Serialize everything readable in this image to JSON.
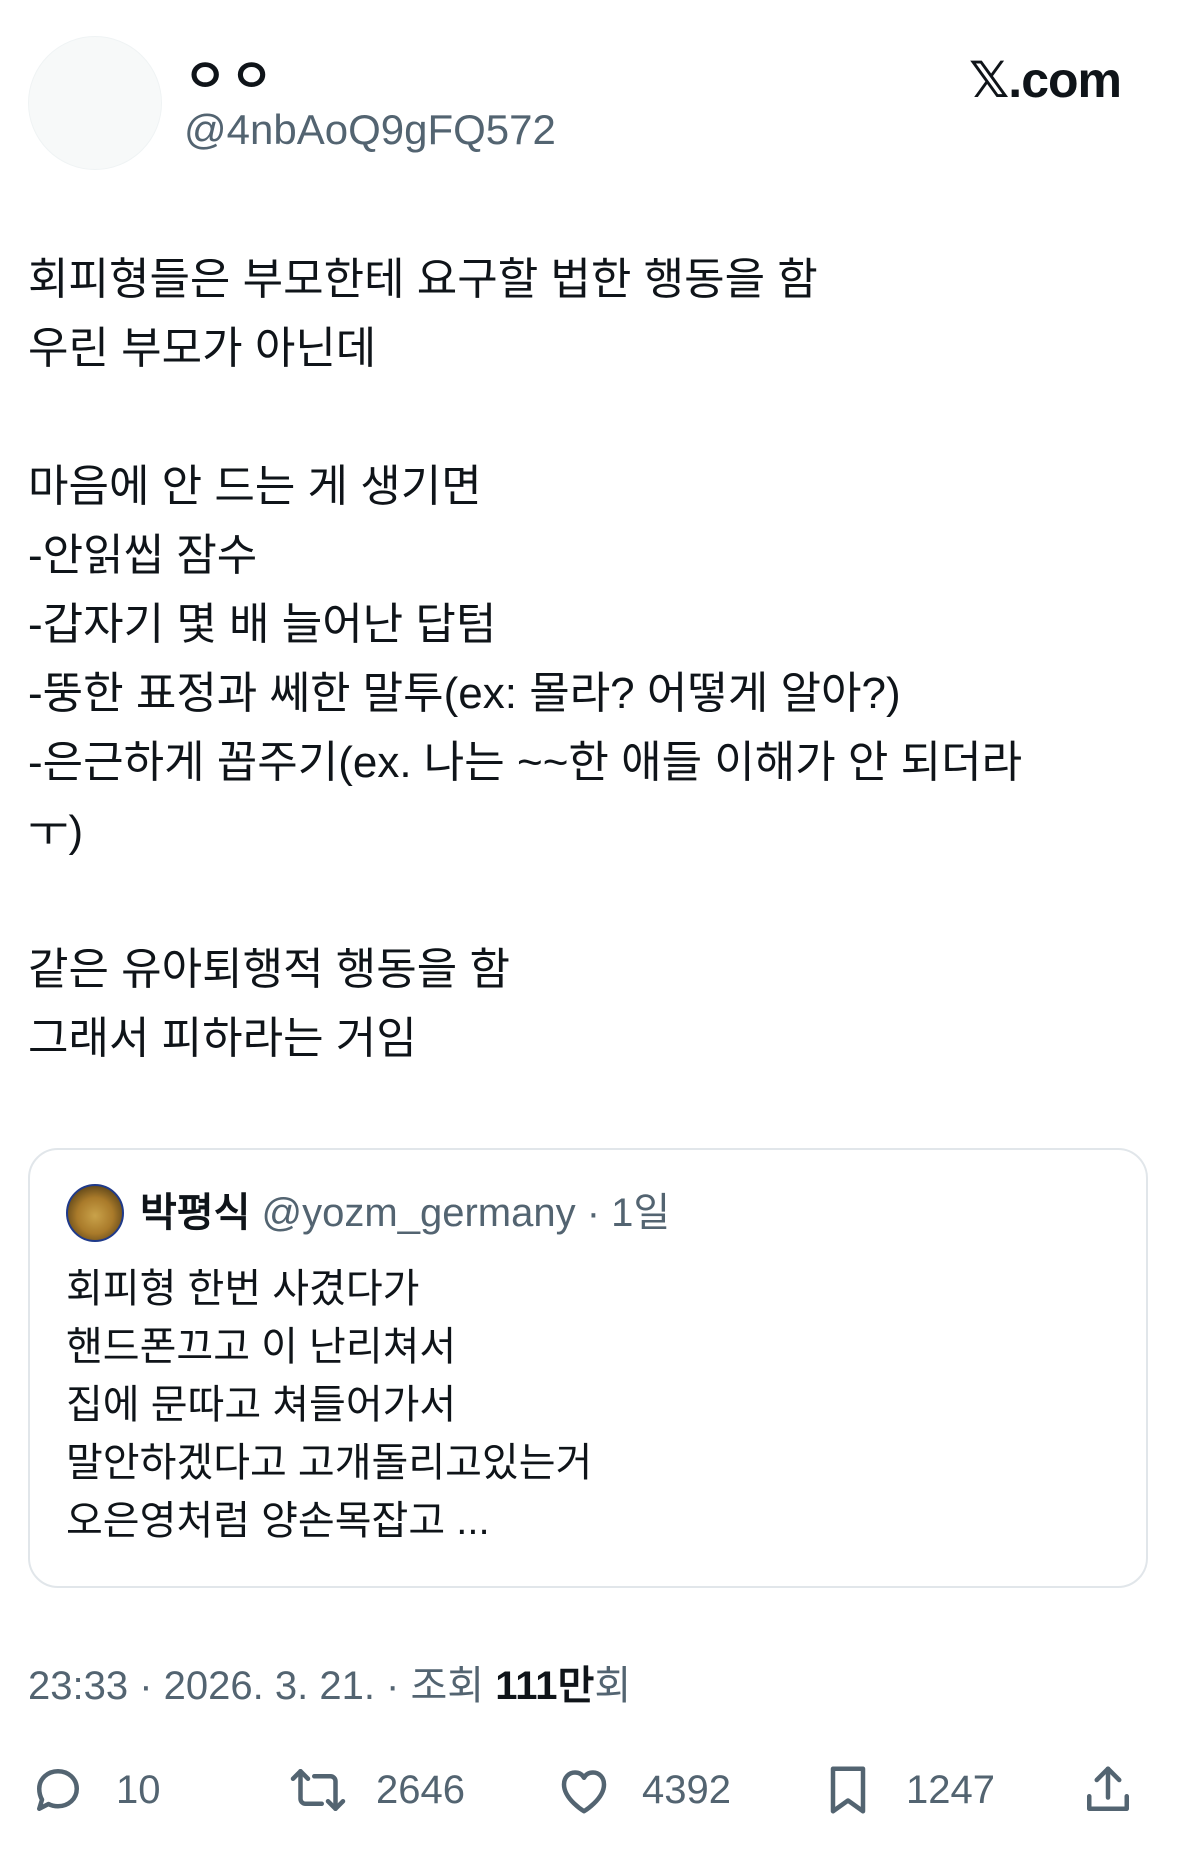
{
  "header": {
    "display_name": "ㅇㅇ",
    "handle": "@4nbAoQ9gFQ572",
    "brand": "𝕏.com"
  },
  "tweet": {
    "lines": [
      "회피형들은 부모한테 요구할 법한 행동을 함",
      "우린 부모가 아닌데",
      "",
      "마음에 안 드는 게 생기면",
      "-안읽씹 잠수",
      "-갑자기 몇 배 늘어난 답텀",
      "-뚱한 표정과 쎄한 말투(ex: 몰라? 어떻게 알아?)",
      "-은근하게 꼽주기(ex. 나는 ~~한 애들 이해가 안 되더라",
      "ㅜ)",
      "",
      "같은 유아퇴행적 행동을 함",
      "그래서 피하라는 거임"
    ]
  },
  "quote": {
    "name": "박평식",
    "meta": "@yozm_germany · 1일",
    "lines": [
      "회피형 한번 사겼다가",
      "핸드폰끄고 이 난리쳐서",
      "집에 문따고 쳐들어가서",
      "말안하겠다고 고개돌리고있는거",
      "오은영처럼 양손목잡고 ..."
    ]
  },
  "meta": {
    "timestamp": "23:33 · 2026. 3. 21. · 조회 ",
    "views_number": "111만",
    "views_suffix": "회"
  },
  "actions": {
    "reply_count": "10",
    "retweet_count": "2646",
    "like_count": "4392",
    "bookmark_count": "1247"
  },
  "colors": {
    "text": "#0f1419",
    "secondary": "#536471",
    "border": "#e1e6ea"
  },
  "icons": [
    "reply-icon",
    "retweet-icon",
    "heart-icon",
    "bookmark-icon",
    "share-icon"
  ]
}
